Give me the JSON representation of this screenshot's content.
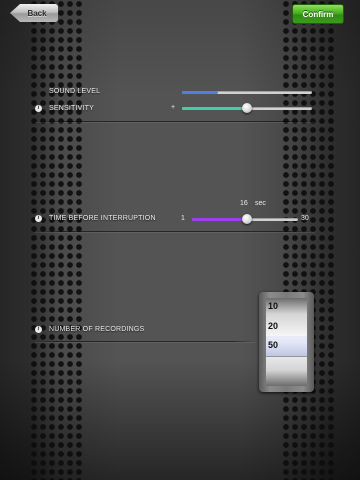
{
  "header": {
    "back_label": "Back",
    "confirm_label": "Confirm"
  },
  "sound_level": {
    "label": "SOUND LEVEL",
    "level": 0.28,
    "fill_color": "#4f7fe0"
  },
  "sensitivity": {
    "label": "SENSITIVITY",
    "plus_text": "+",
    "level": 0.5,
    "fill_color": "#3fd0a8"
  },
  "interruption": {
    "label": "TIME BEFORE INTERRUPTION",
    "value_text": "16",
    "unit": "sec",
    "min_label": "1",
    "max_label": "30",
    "min": 1,
    "max": 30,
    "value": 16,
    "fill_color": "#9b3ff0"
  },
  "recordings": {
    "label": "NUMBER OF RECORDINGS",
    "options": [
      "10",
      "20",
      "50"
    ],
    "selected": "50"
  },
  "icons": {
    "info": "info-icon"
  }
}
